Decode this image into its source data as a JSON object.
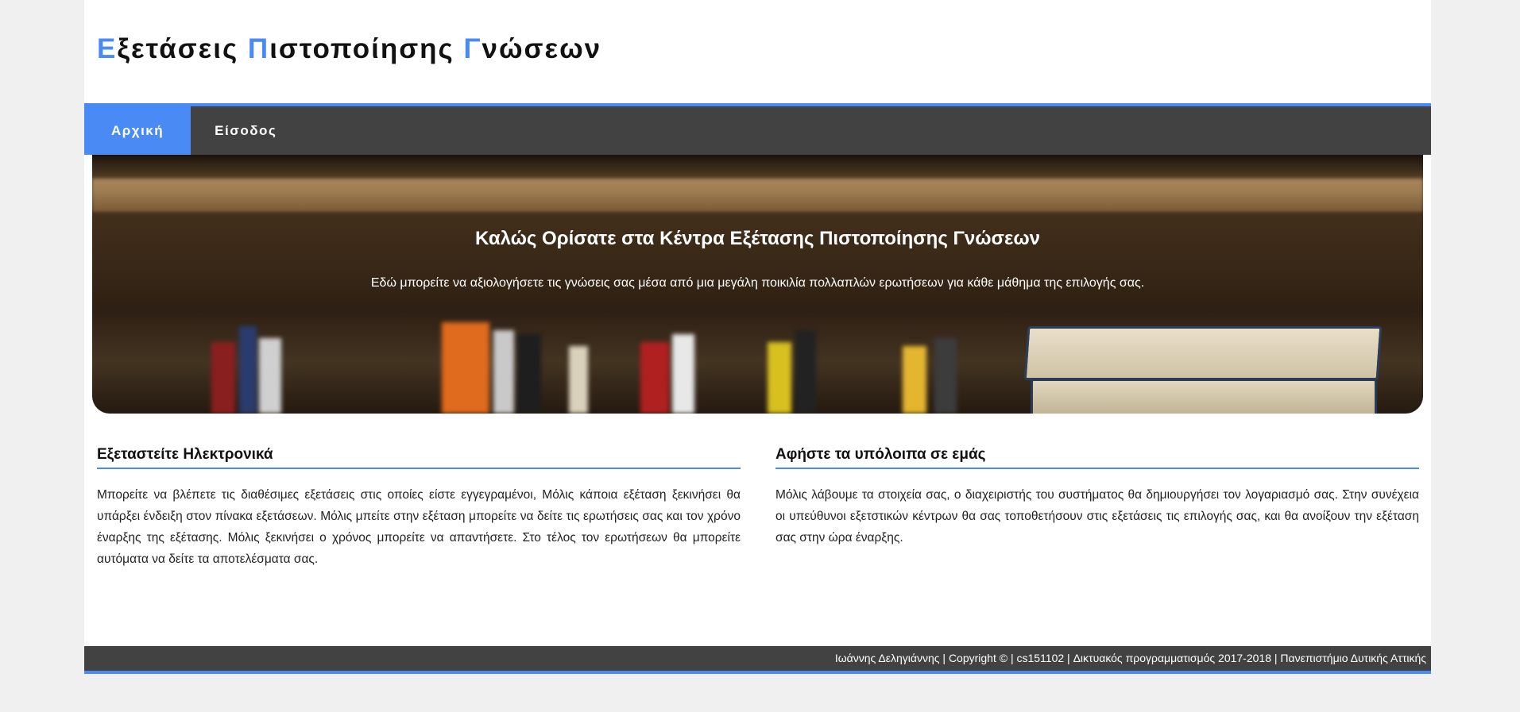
{
  "header": {
    "title_parts": [
      {
        "accent": "Ε",
        "rest": "ξετάσεις "
      },
      {
        "accent": "Π",
        "rest": "ιστοποίησης "
      },
      {
        "accent": "Γ",
        "rest": "νώσεων"
      }
    ]
  },
  "nav": {
    "items": [
      {
        "label": "Αρχική",
        "active": true
      },
      {
        "label": "Είσοδος",
        "active": false
      }
    ]
  },
  "hero": {
    "title": "Καλώς Ορίσατε στα Κέντρα Εξέτασης Πιστοποίησης Γνώσεων",
    "text": "Εδώ μπορείτε να αξιολογήσετε τις γνώσεις σας μέσα από μια μεγάλη ποικιλία πολλαπλών ερωτήσεων για κάθε μάθημα της επιλογής σας."
  },
  "sections": [
    {
      "heading": "Εξεταστείτε Ηλεκτρονικά",
      "text": "Μπορείτε να βλέπετε τις διαθέσιμες εξετάσεις στις οποίες είστε εγγεγραμένοι, Μόλις κάποια εξέταση ξεκινήσει θα υπάρξει ένδειξη στον πίνακα εξετάσεων. Μόλις μπείτε στην εξέταση μπορείτε να δείτε τις ερωτήσεις σας και τον χρόνο έναρξης της εξέτασης. Μόλις ξεκινήσει ο χρόνος μπορείτε να απαντήσετε. Στο τέλος τον ερωτήσεων θα μπορείτε αυτόματα να δείτε τα αποτελέσματα σας."
    },
    {
      "heading": "Αφήστε τα υπόλοιπα σε εμάς",
      "text": "Μόλις λάβουμε τα στοιχεία σας, ο διαχειριστής του συστήματος θα δημιουργήσει τον λογαριασμό σας. Στην συνέχεια οι υπεύθυνοι εξετστικών κέντρων θα σας τοποθετήσουν στις εξετάσεις τις επιλογής σας, και θα ανοίξουν την εξέταση σας στην ώρα έναρξης."
    }
  ],
  "footer": {
    "text": "Ιωάννης Δεληγιάννης | Copyright © | cs151102 | Δικτυακός προγραμματισμός 2017-2018 | Πανεπιστήμιο Δυτικής Αττικής"
  },
  "colors": {
    "accent": "#4a8af4",
    "nav_bg": "#424242",
    "page_bg": "#f0f0f0"
  }
}
